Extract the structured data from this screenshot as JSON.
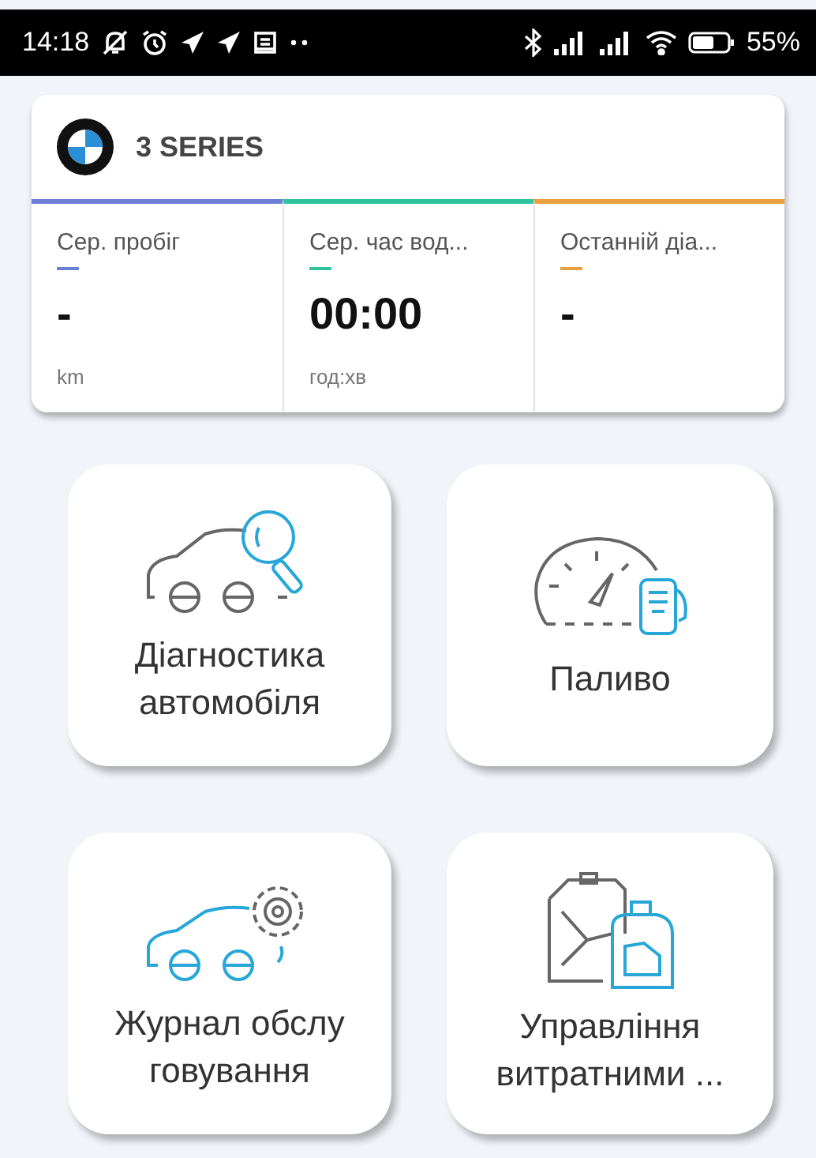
{
  "status_bar": {
    "time": "14:18",
    "battery": "55%"
  },
  "vehicle": {
    "model": "3 SERIES"
  },
  "stats": [
    {
      "label": "Сер. пробіг",
      "color": "#6b7fd7",
      "value": "-",
      "unit": "km"
    },
    {
      "label": "Сер. час вод...",
      "color": "#2fc4a0",
      "value": "00:00",
      "unit": "год:хв"
    },
    {
      "label": "Останній діа...",
      "color": "#e8a040",
      "value": "-"
    }
  ],
  "tiles": [
    {
      "kind": "diagnostics",
      "label_lines": [
        "Діагностика",
        "автомобіля"
      ]
    },
    {
      "kind": "fuel",
      "label_lines": [
        "Паливо"
      ]
    },
    {
      "kind": "service",
      "label_lines": [
        "Журнал обслу",
        "говування"
      ]
    },
    {
      "kind": "consumables",
      "label_lines": [
        "Управління",
        "витратними ..."
      ]
    }
  ]
}
